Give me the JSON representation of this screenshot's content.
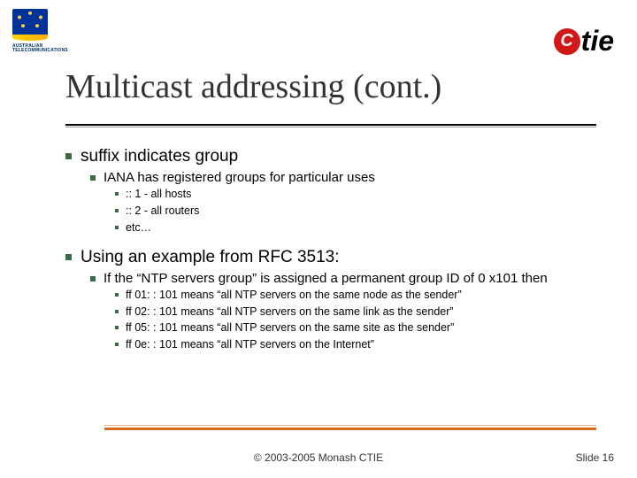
{
  "logos": {
    "left_text": "AUSTRALIAN\nTELECOMMUNICATIONS",
    "right_c": "C",
    "right_tie": "tie"
  },
  "title": "Multicast addressing (cont.)",
  "bullets": {
    "l1a": "suffix indicates group",
    "l2a": "IANA has registered groups for particular uses",
    "l3a": ":: 1 - all hosts",
    "l3b": ":: 2 - all routers",
    "l3c": "etc…",
    "l1b": "Using an example from RFC 3513:",
    "l2b": "If the “NTP servers group” is assigned a permanent group ID of 0 x101 then",
    "l3d": "ff 01: : 101 means “all NTP servers on the same node as the sender”",
    "l3e": "ff 02: : 101 means “all NTP servers on the same link as the sender”",
    "l3f": "ff 05: : 101 means “all NTP servers on the same site as the sender”",
    "l3g": "ff 0e: : 101 means “all NTP servers on the Internet”"
  },
  "footer": {
    "center": "© 2003-2005 Monash CTIE",
    "right": "Slide 16"
  }
}
